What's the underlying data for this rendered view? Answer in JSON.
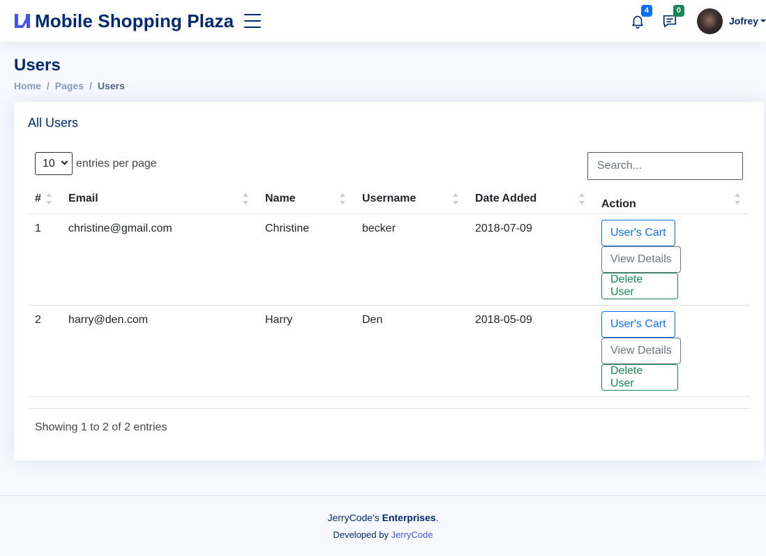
{
  "header": {
    "brand": "Mobile Shopping Plaza",
    "notifications_count": "4",
    "messages_count": "0",
    "profile_name": "Jofrey"
  },
  "page": {
    "title": "Users",
    "breadcrumb": [
      "Home",
      "Pages",
      "Users"
    ]
  },
  "card": {
    "title": "All Users",
    "per_page_value": "10",
    "per_page_label": "entries per page",
    "search_placeholder": "Search...",
    "columns": [
      "#",
      "Email",
      "Name",
      "Username",
      "Date Added",
      "Action"
    ],
    "rows": [
      {
        "num": "1",
        "email": "christine@gmail.com",
        "name": "Christine",
        "username": "becker",
        "date": "2018-07-09"
      },
      {
        "num": "2",
        "email": "harry@den.com",
        "name": "Harry",
        "username": "Den",
        "date": "2018-05-09"
      }
    ],
    "actions": {
      "cart": "User's Cart",
      "view": "View Details",
      "delete": "Delete User"
    },
    "info": "Showing 1 to 2 of 2 entries"
  },
  "footer": {
    "company_prefix": "JerryCode's ",
    "company_strong": "Enterprises",
    "company_suffix": ".",
    "credits_prefix": "Developed by ",
    "credits_link": "JerryCode"
  },
  "colors": {
    "primary": "#012970",
    "accent_blue": "#0d6efd",
    "success": "#198754",
    "secondary": "#6c757d"
  }
}
